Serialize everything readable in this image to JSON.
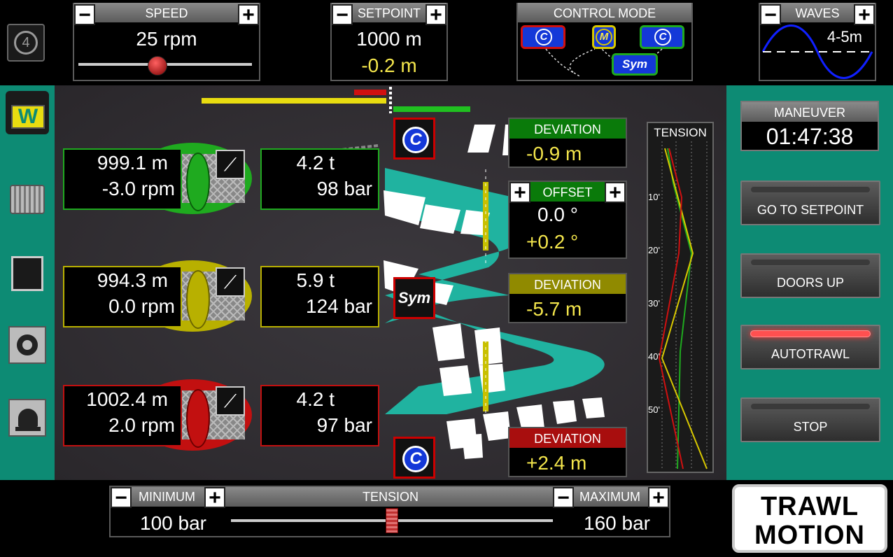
{
  "top": {
    "speed": {
      "label": "SPEED",
      "value": "25 rpm",
      "slider_fraction": 0.45
    },
    "setpoint": {
      "label": "SETPOINT",
      "value": "1000 m",
      "delta": "-0.2 m"
    },
    "control_mode": {
      "label": "CONTROL MODE",
      "left": "C",
      "middle": "M",
      "right": "C",
      "sym": "Sym"
    },
    "waves": {
      "label": "WAVES",
      "value": "4-5m"
    }
  },
  "winches": [
    {
      "length": "999.1 m",
      "rpm": "-3.0 rpm",
      "tension": "4.2 t",
      "pressure": "98 bar",
      "color": "#1faa1f"
    },
    {
      "length": "994.3 m",
      "rpm": "0.0 rpm",
      "tension": "5.9 t",
      "pressure": "124 bar",
      "color": "#b8b000"
    },
    {
      "length": "1002.4 m",
      "rpm": "2.0 rpm",
      "tension": "4.2 t",
      "pressure": "97 bar",
      "color": "#c21010"
    }
  ],
  "control_badges": {
    "top": "C",
    "middle": "Sym",
    "bottom": "C"
  },
  "deviation_top": {
    "label": "DEVIATION",
    "value": "-0.9 m"
  },
  "offset": {
    "label": "OFFSET",
    "value1": "0.0 °",
    "value2": "+0.2 °"
  },
  "deviation_mid": {
    "label": "DEVIATION",
    "value": "-5.7 m"
  },
  "deviation_bot": {
    "label": "DEVIATION",
    "value": "+2.4 m"
  },
  "tension_graph": {
    "label": "TENSION",
    "ticks": [
      "10'",
      "20'",
      "30'",
      "40'",
      "50'"
    ]
  },
  "maneuver": {
    "label": "MANEUVER",
    "time": "01:47:38"
  },
  "buttons": {
    "go_to_setpoint": "GO TO SETPOINT",
    "doors_up": "DOORS UP",
    "autotrawl": "AUTOTRAWL",
    "stop": "STOP"
  },
  "bottom": {
    "minimum_label": "MINIMUM",
    "minimum_value": "100 bar",
    "tension_label": "TENSION",
    "maximum_label": "MAXIMUM",
    "maximum_value": "160 bar",
    "slider_fraction": 0.5
  },
  "logo": {
    "line1": "TRAWL",
    "line2": "MOTION"
  },
  "colors": {
    "green": "#0d8b74",
    "teal": "#20b3a0",
    "yellow": "#f4e64c"
  }
}
